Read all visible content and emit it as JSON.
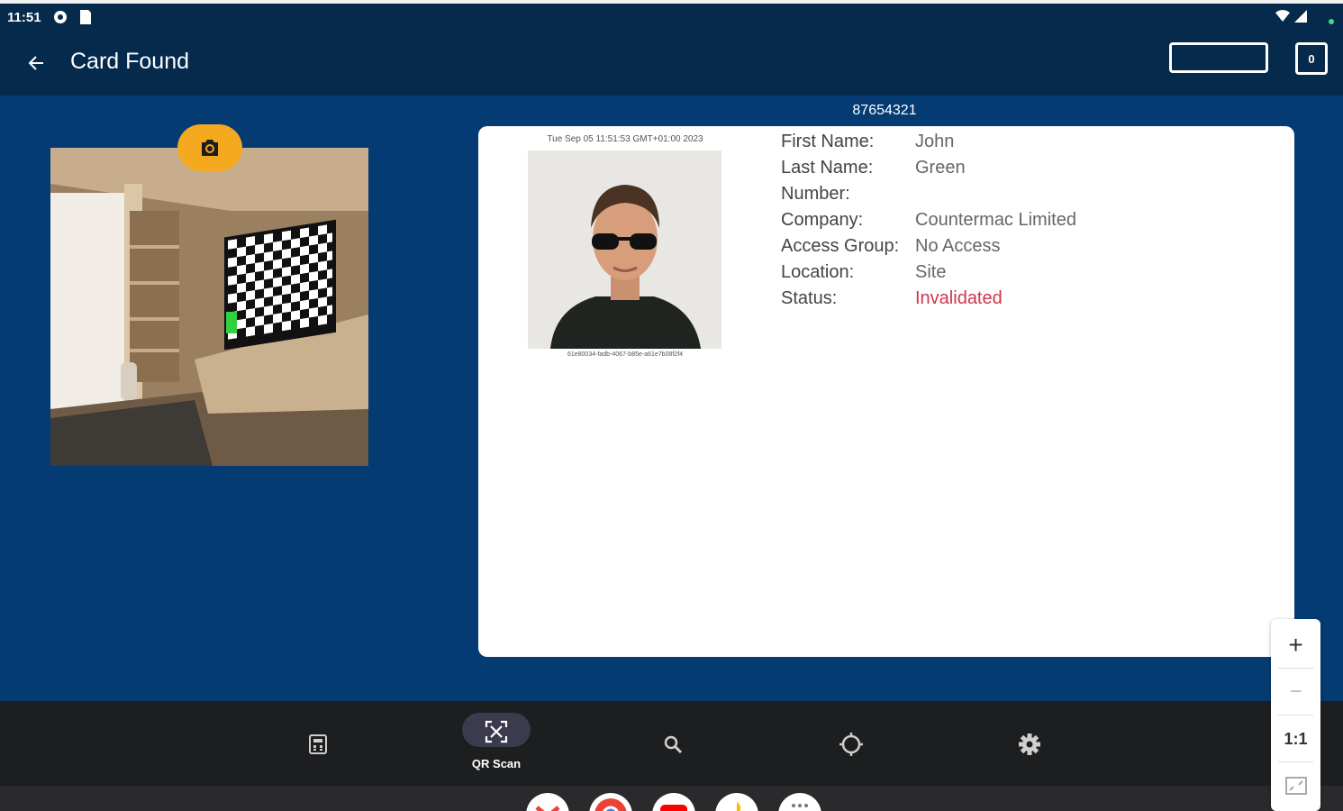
{
  "status_bar": {
    "time": "11:51"
  },
  "app_bar": {
    "title": "Card Found",
    "counter": "0"
  },
  "card": {
    "number": "87654321",
    "photo_timestamp": "Tue Sep 05 11:51:53 GMT+01:00 2023",
    "photo_id": "61e80034-fadb-4067-b85e-a61e7b08f2f4",
    "fields": [
      {
        "label": "First Name:",
        "value": "John"
      },
      {
        "label": "Last Name:",
        "value": "Green"
      },
      {
        "label": "Number:",
        "value": ""
      },
      {
        "label": "Company:",
        "value": "Countermac Limited"
      },
      {
        "label": "Access Group:",
        "value": "No Access"
      },
      {
        "label": "Location:",
        "value": "Site"
      },
      {
        "label": "Status:",
        "value": "Invalidated"
      }
    ]
  },
  "bottom_nav": [
    {
      "icon": "calculator-icon",
      "label": ""
    },
    {
      "icon": "qr-scan-icon",
      "label": "QR Scan",
      "active": true
    },
    {
      "icon": "search-icon",
      "label": ""
    },
    {
      "icon": "locate-icon",
      "label": ""
    },
    {
      "icon": "gear-icon",
      "label": ""
    }
  ],
  "zoom_controls": {
    "zoom_in": "+",
    "zoom_out": "−",
    "ratio": "1:1"
  },
  "colors": {
    "app_bar": "#052a4c",
    "background": "#053b73",
    "camera_button": "#f4a91f",
    "invalid": "#d0344a",
    "nav": "#1d1e20"
  }
}
